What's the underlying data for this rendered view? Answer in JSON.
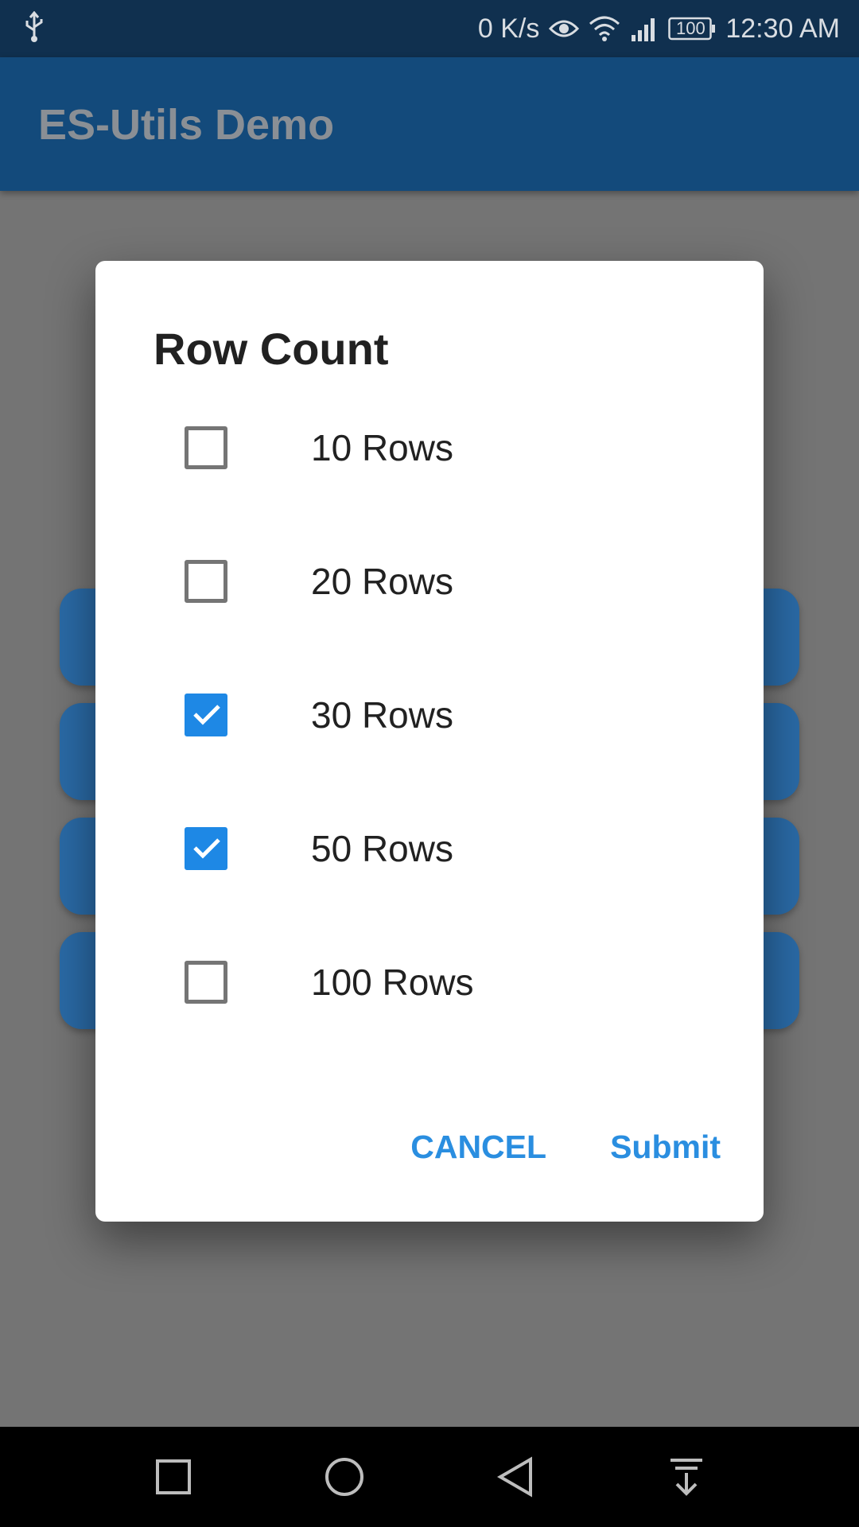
{
  "status_bar": {
    "network_speed": "0 K/s",
    "battery": "100",
    "time": "12:30 AM",
    "icons": [
      "usb-icon",
      "eye-icon",
      "wifi-icon",
      "signal-icon",
      "battery-icon"
    ]
  },
  "app_bar": {
    "title": "ES-Utils Demo"
  },
  "dialog": {
    "title": "Row Count",
    "options": [
      {
        "label": "10 Rows",
        "checked": false
      },
      {
        "label": "20 Rows",
        "checked": false
      },
      {
        "label": "30 Rows",
        "checked": true
      },
      {
        "label": "50 Rows",
        "checked": true
      },
      {
        "label": "100 Rows",
        "checked": false
      }
    ],
    "cancel_label": "CANCEL",
    "submit_label": "Submit"
  },
  "nav_bar": {
    "icons": [
      "recents-icon",
      "home-icon",
      "back-icon",
      "notification-pull-icon"
    ]
  },
  "colors": {
    "accent": "#1e88e5",
    "app_bar": "#134a7b",
    "status_bar": "#10304f"
  }
}
